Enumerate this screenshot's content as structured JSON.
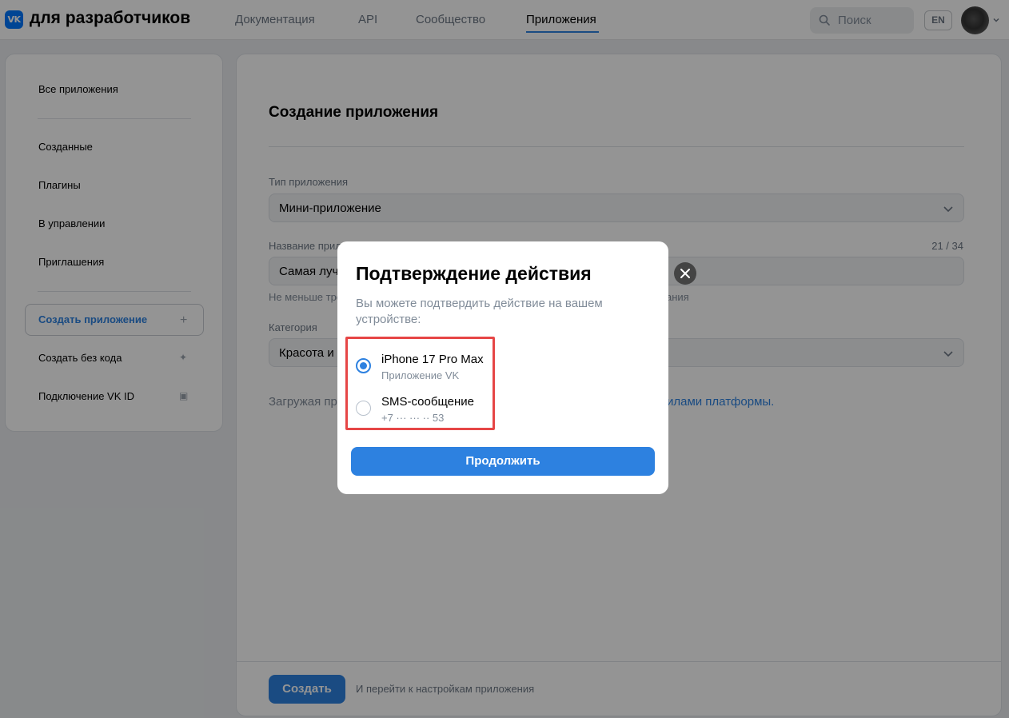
{
  "header": {
    "logo_text": "VK",
    "brand": "для разработчиков",
    "nav": [
      "Документация",
      "API",
      "Сообщество",
      "Приложения"
    ],
    "search_placeholder": "Поиск",
    "lang": "EN"
  },
  "sidebar": {
    "all_apps": "Все приложения",
    "items": [
      "Созданные",
      "Плагины",
      "В управлении",
      "Приглашения"
    ],
    "create_app": "Создать приложение",
    "create_no_code": "Создать без кода",
    "vk_id": "Подключение VK ID"
  },
  "main": {
    "title": "Создание приложения",
    "type_label": "Тип приложения",
    "type_value": "Мини-приложение",
    "name_label": "Название прил",
    "name_counter": "21 / 34",
    "name_value": "Самая луч",
    "name_hint_left": "Не меньше тре",
    "name_hint_right": "ания",
    "category_label": "Категория",
    "category_value": "Красота и з",
    "terms_left": "Загружая пр",
    "terms_link": "вилами платформы.",
    "create_button": "Создать",
    "create_note": "И перейти к настройкам приложения"
  },
  "modal": {
    "title": "Подтверждение действия",
    "description": "Вы можете подтвердить действие на вашем устройстве:",
    "options": [
      {
        "title": "iPhone 17 Pro Max",
        "subtitle": "Приложение VK",
        "selected": true
      },
      {
        "title": "SMS-сообщение",
        "subtitle": "+7 ··· ··· ·· 53",
        "selected": false
      }
    ],
    "continue_button": "Продолжить"
  },
  "colors": {
    "accent": "#2d81e0",
    "highlight": "#e64646"
  }
}
